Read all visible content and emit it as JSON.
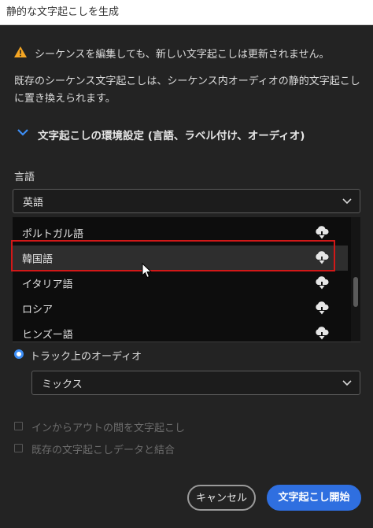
{
  "window": {
    "title": "静的な文字起こしを生成"
  },
  "warning": {
    "text": "シーケンスを編集しても、新しい文字起こしは更新されません。"
  },
  "description": "既存のシーケンス文字起こしは、シーケンス内オーディオの静的文字起こしに置き換えられます。",
  "section": {
    "title": "文字起こしの環境設定 (言語、ラベル付け、オーディオ)"
  },
  "language": {
    "label": "言語",
    "selected": "英語",
    "options": [
      {
        "label": "ポルトガル語",
        "icon": "cloud-download-icon"
      },
      {
        "label": "韓国語",
        "icon": "cloud-download-icon"
      },
      {
        "label": "イタリア語",
        "icon": "cloud-download-icon"
      },
      {
        "label": "ロシア",
        "icon": "cloud-download-icon"
      },
      {
        "label": "ヒンズー語",
        "icon": "cloud-download-icon"
      }
    ],
    "hovered_option": "韓国語"
  },
  "audio": {
    "radio_label": "トラック上のオーディオ",
    "selected": "ミックス"
  },
  "checkboxes": [
    {
      "label": "インからアウトの間を文字起こし",
      "checked": false,
      "enabled": false
    },
    {
      "label": "既存の文字起こしデータと結合",
      "checked": false,
      "enabled": false
    }
  ],
  "buttons": {
    "cancel": "キャンセル",
    "start": "文字起こし開始"
  },
  "colors": {
    "background": "#232323",
    "accent": "#2f6fe0",
    "warning": "#f5a623",
    "highlight_box": "#d21818"
  }
}
